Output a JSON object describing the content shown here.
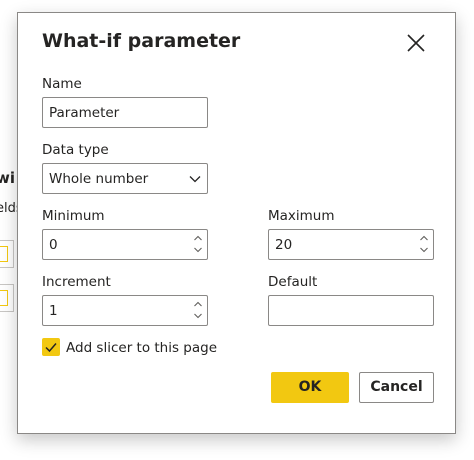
{
  "background": {
    "fragment_1": "wi",
    "fragment_2": "elds"
  },
  "dialog": {
    "title": "What-if parameter",
    "name_label": "Name",
    "name_value": "Parameter",
    "data_type_label": "Data type",
    "data_type_value": "Whole number",
    "minimum_label": "Minimum",
    "minimum_value": "0",
    "maximum_label": "Maximum",
    "maximum_value": "20",
    "increment_label": "Increment",
    "increment_value": "1",
    "default_label": "Default",
    "default_value": "",
    "slicer_label": "Add slicer to this page",
    "slicer_checked": true,
    "ok_label": "OK",
    "cancel_label": "Cancel"
  },
  "colors": {
    "accent": "#f2c811",
    "border": "#8a8886",
    "text": "#252423"
  },
  "icons": {
    "close": "close-icon",
    "dropdown": "chevron-down-icon",
    "spin_up": "chevron-up-icon",
    "spin_down": "chevron-down-icon",
    "check": "checkmark-icon"
  }
}
